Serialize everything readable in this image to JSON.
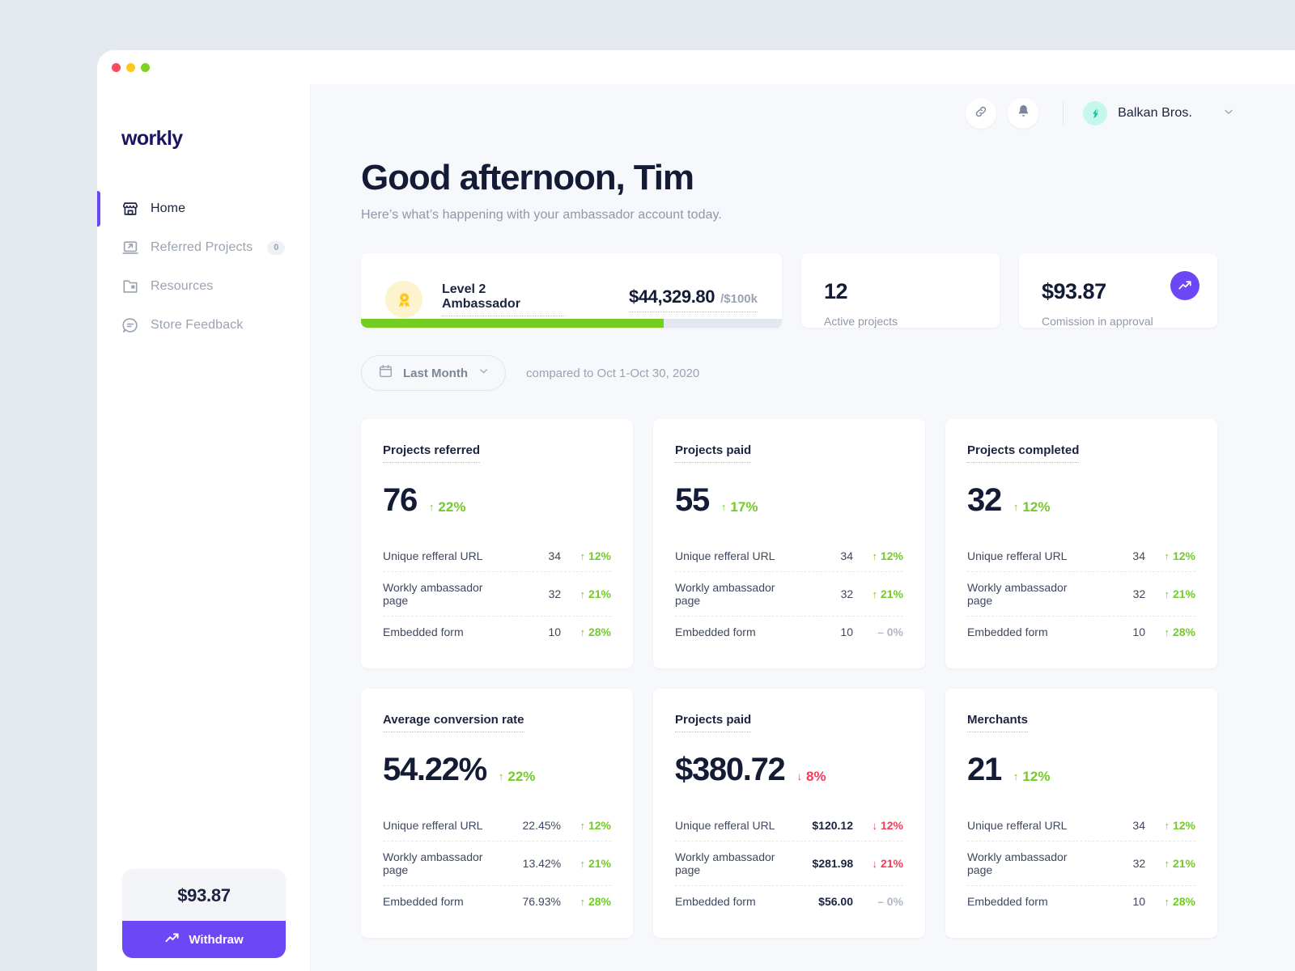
{
  "window": {
    "dots": [
      "close",
      "minimize",
      "maximize"
    ]
  },
  "sidebar": {
    "logo": "workly",
    "items": [
      {
        "label": "Home",
        "icon": "store-icon",
        "badge": null,
        "active": true
      },
      {
        "label": "Referred Projects",
        "icon": "referred-projects-icon",
        "badge": "0",
        "active": false
      },
      {
        "label": "Resources",
        "icon": "folder-icon",
        "badge": null,
        "active": false
      },
      {
        "label": "Store Feedback",
        "icon": "chat-icon",
        "badge": null,
        "active": false
      }
    ],
    "balance_amount": "$93.87",
    "withdraw_label": "Withdraw"
  },
  "topbar": {
    "link_icon": "link-icon",
    "bell_icon": "bell-icon",
    "account_name": "Balkan Bros.",
    "caret_icon": "chevron-down-icon"
  },
  "header": {
    "greeting": "Good afternoon, Tim",
    "subtitle": "Here’s what’s happening with your ambassador account today."
  },
  "level_card": {
    "medal_icon": "award-icon",
    "level_label": "Level 2 Ambassador",
    "amount": "$44,329.80",
    "goal": "/$100k",
    "progress_percent": 72
  },
  "kpis": [
    {
      "value": "12",
      "label": "Active projects",
      "badge_icon": null
    },
    {
      "value": "$93.87",
      "label": "Comission in approval",
      "badge_icon": "trend-up-icon"
    }
  ],
  "filter": {
    "calendar_icon": "calendar-icon",
    "period": "Last Month",
    "caret_icon": "chevron-down-icon",
    "compare": "compared to Oct 1-Oct 30, 2020"
  },
  "metrics": [
    {
      "title": "Projects referred",
      "value": "76",
      "delta": "22%",
      "direction": "up",
      "bold_values": false,
      "rows": [
        {
          "name": "Unique refferal URL",
          "value": "34",
          "change": "12%",
          "direction": "up"
        },
        {
          "name": "Workly ambassador page",
          "value": "32",
          "change": "21%",
          "direction": "up"
        },
        {
          "name": "Embedded form",
          "value": "10",
          "change": "28%",
          "direction": "up"
        }
      ]
    },
    {
      "title": "Projects paid",
      "value": "55",
      "delta": "17%",
      "direction": "up",
      "bold_values": false,
      "rows": [
        {
          "name": "Unique refferal URL",
          "value": "34",
          "change": "12%",
          "direction": "up"
        },
        {
          "name": "Workly ambassador page",
          "value": "32",
          "change": "21%",
          "direction": "up"
        },
        {
          "name": "Embedded form",
          "value": "10",
          "change": "0%",
          "direction": "flat"
        }
      ]
    },
    {
      "title": "Projects completed",
      "value": "32",
      "delta": "12%",
      "direction": "up",
      "bold_values": false,
      "rows": [
        {
          "name": "Unique refferal URL",
          "value": "34",
          "change": "12%",
          "direction": "up"
        },
        {
          "name": "Workly ambassador page",
          "value": "32",
          "change": "21%",
          "direction": "up"
        },
        {
          "name": "Embedded form",
          "value": "10",
          "change": "28%",
          "direction": "up"
        }
      ]
    },
    {
      "title": "Average conversion rate",
      "value": "54.22%",
      "delta": "22%",
      "direction": "up",
      "bold_values": false,
      "rows": [
        {
          "name": "Unique refferal URL",
          "value": "22.45%",
          "change": "12%",
          "direction": "up"
        },
        {
          "name": "Workly ambassador page",
          "value": "13.42%",
          "change": "21%",
          "direction": "up"
        },
        {
          "name": "Embedded form",
          "value": "76.93%",
          "change": "28%",
          "direction": "up"
        }
      ]
    },
    {
      "title": "Projects paid",
      "value": "$380.72",
      "delta": "8%",
      "direction": "down",
      "bold_values": true,
      "rows": [
        {
          "name": "Unique refferal URL",
          "value": "$120.12",
          "change": "12%",
          "direction": "down"
        },
        {
          "name": "Workly ambassador page",
          "value": "$281.98",
          "change": "21%",
          "direction": "down"
        },
        {
          "name": "Embedded form",
          "value": "$56.00",
          "change": "0%",
          "direction": "flat"
        }
      ]
    },
    {
      "title": "Merchants",
      "value": "21",
      "delta": "12%",
      "direction": "up",
      "bold_values": false,
      "rows": [
        {
          "name": "Unique refferal URL",
          "value": "34",
          "change": "12%",
          "direction": "up"
        },
        {
          "name": "Workly ambassador page",
          "value": "32",
          "change": "21%",
          "direction": "up"
        },
        {
          "name": "Embedded form",
          "value": "10",
          "change": "28%",
          "direction": "up"
        }
      ]
    }
  ],
  "colors": {
    "accent": "#6c47f5",
    "positive": "#72cb26",
    "negative": "#f53b57",
    "neutral": "#aeb7c6",
    "progress": "#76cd21",
    "page_bg": "#e4e8ef",
    "main_bg": "#f6f8fb"
  }
}
